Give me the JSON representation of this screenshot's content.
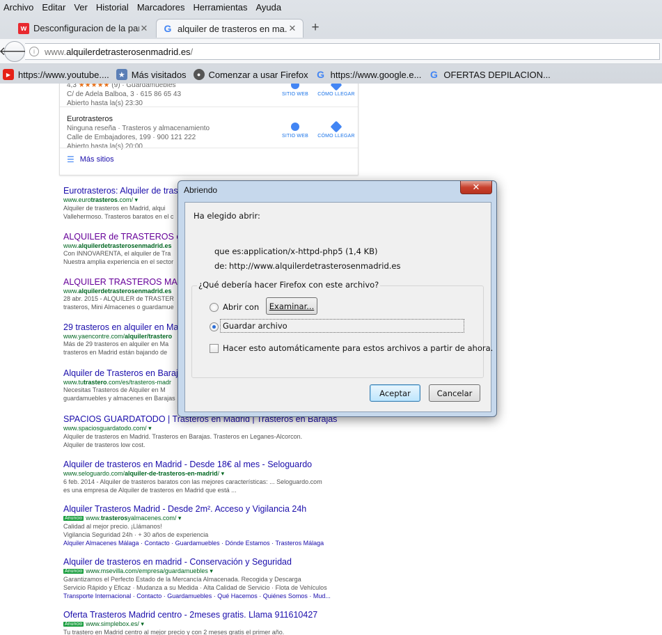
{
  "menubar": [
    "Archivo",
    "Editar",
    "Ver",
    "Historial",
    "Marcadores",
    "Herramientas",
    "Ayuda"
  ],
  "tabs": [
    {
      "title": "Desconfiguracion de la par...",
      "favicon": "wowhead-icon",
      "close": "✕"
    },
    {
      "title": "alquiler de trasteros en ma...",
      "favicon": "google-icon",
      "close": "✕"
    }
  ],
  "new_tab": "+",
  "navbar": {
    "back": "🡐",
    "url_prefix": "www.",
    "url_host": "alquilerdetrasterosenmadrid.es",
    "url_suffix": "/"
  },
  "bookmarks": [
    {
      "label": "https://www.youtube....",
      "icon": "youtube-icon",
      "glyph": "▶"
    },
    {
      "label": "Más visitados",
      "icon": "most-visited-icon",
      "glyph": "★"
    },
    {
      "label": "Comenzar a usar Firefox",
      "icon": "firefox-icon",
      "glyph": "●"
    },
    {
      "label": "https://www.google.e...",
      "icon": "google-icon",
      "glyph": "G"
    },
    {
      "label": "OFERTAS DEPILACION...",
      "icon": "google-icon",
      "glyph": "G"
    }
  ],
  "local": {
    "entries": [
      {
        "rating": "4,3",
        "stars": "★★★★★",
        "reviews": "(9) · Guardamuebles",
        "address": "C/ de Adela Balboa, 3 · 615 86 65 43",
        "hours": "Abierto hasta la(s) 23:30"
      },
      {
        "name": "Eurotrasteros",
        "category": "Ninguna reseña · Trasteros y almacenamiento",
        "address": "Calle de Embajadores, 199 · 900 121 222",
        "hours": "Abierto hasta la(s) 20:00"
      }
    ],
    "website_label": "SITIO WEB",
    "directions_label": "CÓMO LLEGAR",
    "more_sites": "Más sitios"
  },
  "results": [
    {
      "title": "Eurotrasteros: Alquiler de tras",
      "cite_pre": "www.euro",
      "cite_bold": "trasteros",
      "cite_post": ".com/ ▾",
      "snippet1": "Alquiler de trasteros en Madrid, alqui",
      "snippet2": "Vallehermoso. Trasteros baratos en el c"
    },
    {
      "title": "ALQUILER de TRASTEROS en",
      "cite_pre": "www.",
      "cite_bold": "alquilerdetrasterosenmadrid.es",
      "cite_post": "",
      "snippet1": "Con INNOVARENTA, el alquiler de Tra",
      "snippet2": "Nuestra amplia experiencia en el sector"
    },
    {
      "title": "ALQUILER TRASTEROS MADR",
      "cite_pre": "www.",
      "cite_bold": "alquilerdetrasterosenmadrid.es",
      "cite_post": "",
      "snippet1": "28 abr. 2015 - ALQUILER de TRASTER",
      "snippet2": "trasteros, Mini Almacenes o guardamue"
    },
    {
      "title": "29 trasteros en alquiler en Mad",
      "cite_pre": "www.yaencontre.com/",
      "cite_bold": "alquiler/trastero",
      "cite_post": "",
      "snippet1": "Más de 29 trasteros en alquiler en Ma",
      "snippet2": "trasteros en Madrid están bajando de"
    },
    {
      "title": "Alquiler de Trasteros en Baraj",
      "cite_pre": "www.tu",
      "cite_bold": "trastero",
      "cite_post": ".com/es/trasteros-madr",
      "snippet1": "Necesitas Trasteros de Alquiler en M",
      "snippet2": "guardamuebles y almacenes en Barajas"
    },
    {
      "title": "SPACIOS GUARDATODO | Trasteros en Madrid | Trasteros en Barajas",
      "cite_pre": "www.spaciosguardatodo.com/ ▾",
      "cite_bold": "",
      "cite_post": "",
      "snippet1": "Alquiler de trasteros en Madrid. Trasteros en Barajas. Trasteros en Leganes-Alcorcon.",
      "snippet2": "Alquiler de trasteros low cost."
    },
    {
      "title": "Alquiler de trasteros en Madrid - Desde 18€ al mes - Seloguardo",
      "cite_pre": "www.seloguardo.com/",
      "cite_bold": "alquiler-de-trasteros-en-madrid",
      "cite_post": "/ ▾",
      "snippet1": "6 feb. 2014 - Alquiler de trasteros baratos con las mejores características: ... Seloguardo.com",
      "snippet2": "es una empresa de Alquiler de trasteros en Madrid que está ..."
    },
    {
      "title": "Alquiler Trasteros Madrid - Desde 2m². Acceso y Vigilancia 24h",
      "ad": "Anuncio",
      "cite_pre": "www.",
      "cite_bold": "trasteros",
      "cite_post": "yalmacenes.com/ ▾",
      "snippet1": "Calidad al mejor precio. ¡Llámanos!",
      "snippet2": "Vigilancia Seguridad 24h · + 30 años de experiencia",
      "links": "Alquiler Almacenes Málaga · Contacto · Guardamuebles · Dónde Estamos · Trasteros Málaga"
    },
    {
      "title": "Alquiler de trasteros en madrid - Conservación y Seguridad",
      "ad": "Anuncio",
      "cite_pre": "www.msevilla.com/empresa/guardamuebles ▾",
      "cite_bold": "",
      "cite_post": "",
      "snippet1": "Garantizamos el Perfecto Estado de la Mercancía Almacenada. Recogida y Descarga",
      "snippet2": "Servicio Rápido y Eficaz · Mudanza a su Medida · Alta Calidad de Servicio · Flota de Vehículos",
      "links": "Transporte Internacional · Contacto · Guardamuebles · Qué Hacemos · Quiénes Somos · Mud..."
    },
    {
      "title": "Oferta Trasteros Madrid centro - 2meses gratis. Llama 911610427",
      "ad": "Anuncio",
      "cite_pre": "www.simplebox.es/ ▾",
      "cite_bold": "",
      "cite_post": "",
      "snippet1": "Tu trastero en Madrid centro al mejor precio y con 2 meses gratis el primer año.",
      "snippet2": ""
    }
  ],
  "dialog": {
    "title": "Abriendo",
    "close": "✕",
    "chosen": "Ha elegido abrir:",
    "type_label": "que es:",
    "type_value": "application/x-httpd-php5 (1,4 KB)",
    "from_label": "de:",
    "from_value": "http://www.alquilerdetrasterosenmadrid.es",
    "question": "¿Qué debería hacer Firefox con este archivo?",
    "open_with": "Abrir con",
    "browse": "Examinar...",
    "save_file": "Guardar archivo",
    "auto": "Hacer esto automáticamente para estos archivos a partir de ahora.",
    "accept": "Aceptar",
    "cancel": "Cancelar"
  }
}
